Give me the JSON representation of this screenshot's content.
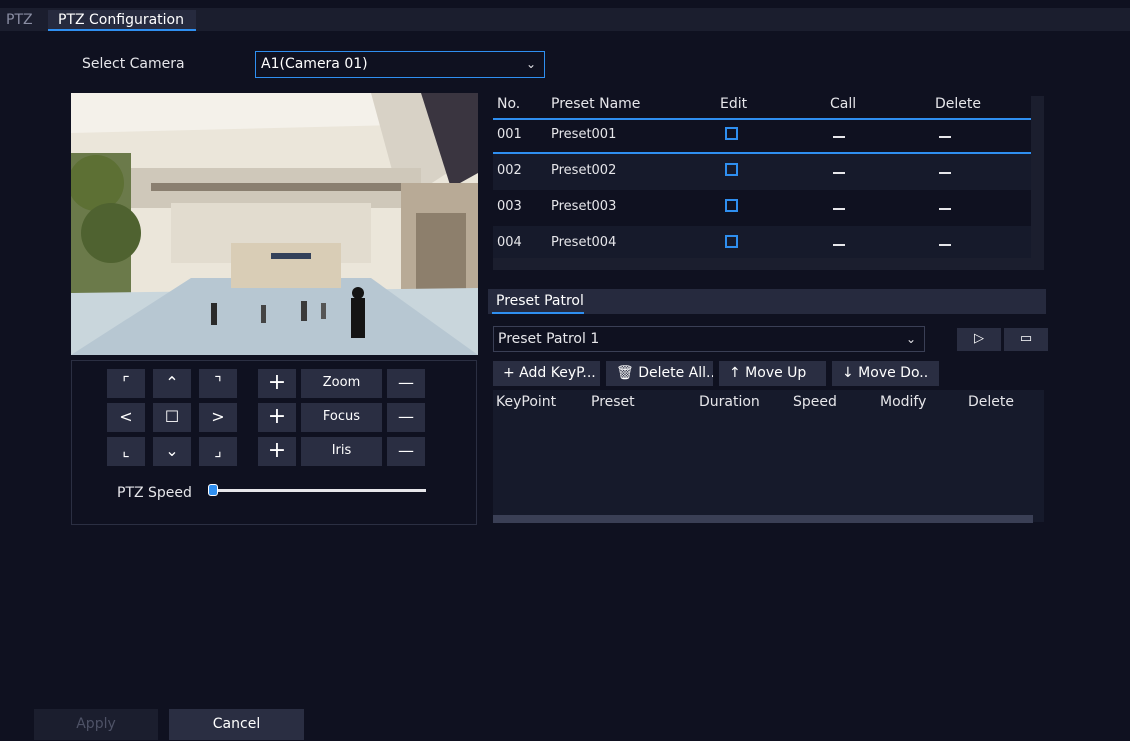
{
  "tabs": [
    {
      "label": "PTZ"
    },
    {
      "label": "PTZ Configuration"
    }
  ],
  "select_camera": {
    "label": "Select Camera",
    "value": "A1(Camera 01)"
  },
  "ptz_controls": {
    "arrows": [
      "⌜",
      "⌃",
      "⌝",
      "<",
      "☐",
      ">",
      "⌞",
      "⌄",
      "⌟"
    ],
    "zoom_label": "Zoom",
    "focus_label": "Focus",
    "iris_label": "Iris",
    "plus": "+",
    "minus": "—",
    "speed_label": "PTZ Speed",
    "speed_level": 0.02
  },
  "preset_table": {
    "headers": {
      "no": "No.",
      "name": "Preset Name",
      "edit": "Edit",
      "call": "Call",
      "delete": "Delete"
    },
    "rows": [
      {
        "no": "001",
        "name": "Preset001",
        "call": "—",
        "delete": "—"
      },
      {
        "no": "002",
        "name": "Preset002",
        "call": "—",
        "delete": "—"
      },
      {
        "no": "003",
        "name": "Preset003",
        "call": "—",
        "delete": "—"
      },
      {
        "no": "004",
        "name": "Preset004",
        "call": "—",
        "delete": "—"
      }
    ]
  },
  "patrol": {
    "title": "Preset Patrol",
    "selected": "Preset Patrol 1",
    "play": "▷",
    "stop": "▭",
    "buttons": {
      "add": "+ Add KeyP...",
      "delete_all": "🗑 Delete All...",
      "move_up": "↑  Move Up",
      "move_down": "↓  Move Do.."
    },
    "headers": {
      "keypoint": "KeyPoint",
      "preset": "Preset",
      "duration": "Duration",
      "speed": "Speed",
      "modify": "Modify",
      "delete": "Delete"
    }
  },
  "footer": {
    "apply": "Apply",
    "cancel": "Cancel"
  },
  "colors": {
    "accent": "#2f8ff0",
    "background": "#0f1120",
    "button": "#2a2e42"
  }
}
